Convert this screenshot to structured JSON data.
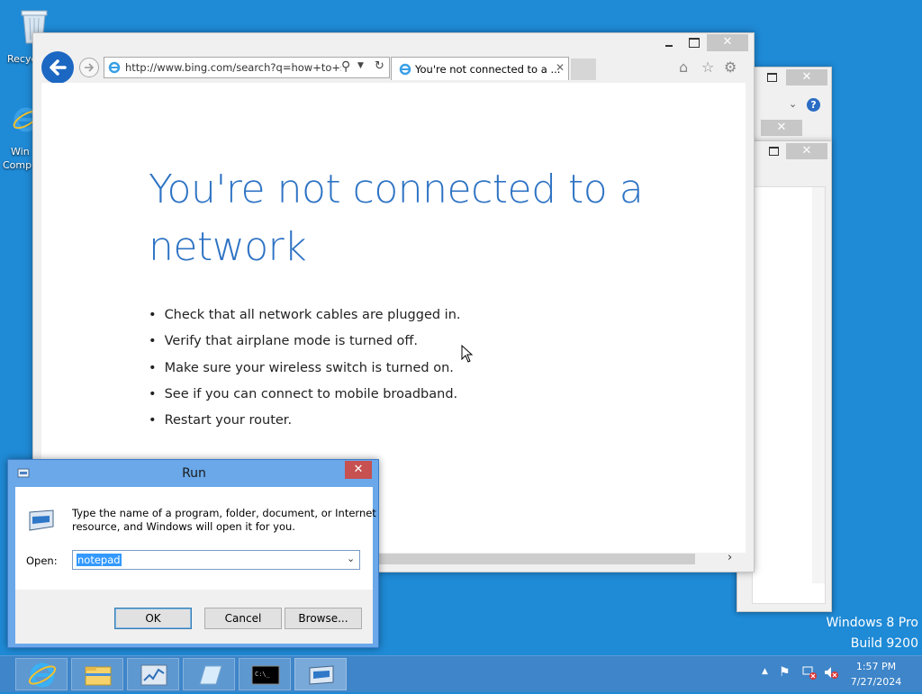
{
  "desktop": {
    "icons": [
      {
        "label": "Recycle Bin",
        "visible_label": "Recyc"
      },
      {
        "label": "Windows Computer",
        "visible_label_1": "Win",
        "visible_label_2": "Comp"
      }
    ],
    "watermark": {
      "line1": "Windows 8 Pro",
      "line2": "Build 9200"
    }
  },
  "ie": {
    "address": "http://www.bing.com/search?q=how+to+st",
    "tab_title": "You're not connected to a ...",
    "heading_line1": "You're not connected to a",
    "heading_line2": "network",
    "bullets": [
      "Check that all network cables are plugged in.",
      "Verify that airplane mode is turned off.",
      "Make sure your wireless switch is turned on.",
      "See if you can connect to mobile broadband.",
      "Restart your router."
    ]
  },
  "run": {
    "title": "Run",
    "description_line1": "Type the name of a program, folder, document, or Internet",
    "description_line2": "resource, and Windows will open it for you.",
    "open_label": "Open:",
    "open_value": "notepad",
    "ok_label": "OK",
    "cancel_label": "Cancel",
    "browse_label": "Browse..."
  },
  "taskbar": {
    "items": [
      "internet-explorer",
      "file-explorer",
      "task-manager",
      "app",
      "command-prompt",
      "run"
    ],
    "time": "1:57 PM",
    "date": "7/27/2024"
  },
  "colors": {
    "desktop": "#1f8ad6",
    "heading": "#2e73c4",
    "close_red": "#c75050",
    "taskbar": "#3e85c9",
    "selection": "#3399ff"
  }
}
